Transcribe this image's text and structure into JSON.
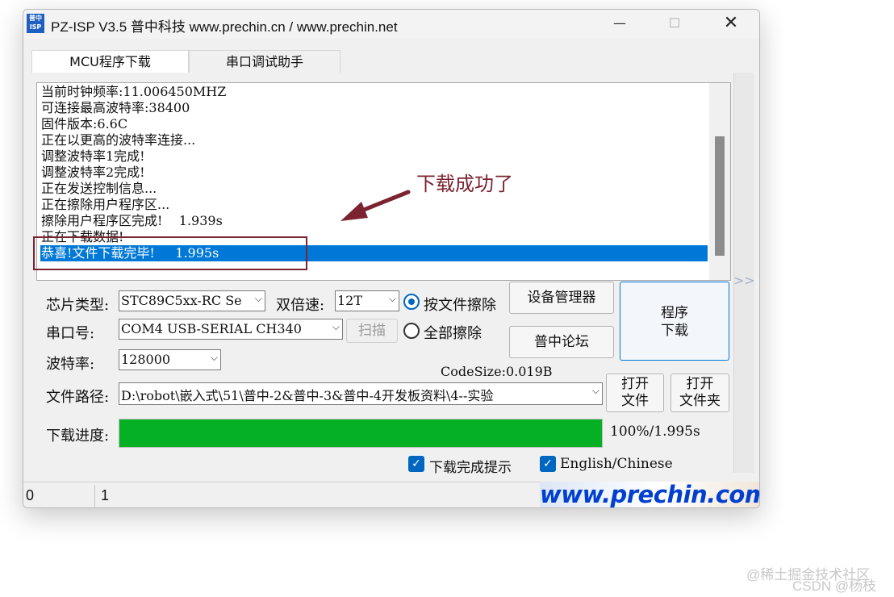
{
  "window": {
    "logo_text": "普中ISP",
    "title": "PZ-ISP V3.5 普中科技  www.prechin.cn / www.prechin.net",
    "minimize": "—",
    "maximize": "☐",
    "close": "✕"
  },
  "tabs": [
    {
      "label": "MCU程序下载",
      "active": true
    },
    {
      "label": "串口调试助手",
      "active": false
    }
  ],
  "log": {
    "lines": [
      "当前时钟频率:11.006450MHZ",
      "可连接最高波特率:38400",
      "固件版本:6.6C",
      "正在以更高的波特率连接...",
      "调整波特率1完成!",
      "调整波特率2完成!",
      "正在发送控制信息...",
      "正在擦除用户程序区...",
      "擦除用户程序区完成!    1.939s",
      "正在下载数据!"
    ],
    "selected_line": "恭喜!文件下载完毕!     1.995s"
  },
  "side_arrows": ">>",
  "form": {
    "chip_label": "芯片类型:",
    "chip_value": "STC89C5xx-RC Se",
    "double_speed_label": "双倍速:",
    "double_speed_value": "12T",
    "erase_by_file": "按文件擦除",
    "erase_all": "全部擦除",
    "erase_mode_selected": "按文件擦除",
    "device_manager": "设备管理器",
    "forum": "普中论坛",
    "program_line1": "程序",
    "program_line2": "下载",
    "port_label": "串口号:",
    "port_value": "COM4  USB-SERIAL CH340",
    "scan_button": "扫描",
    "baud_label": "波特率:",
    "baud_value": "128000",
    "codesize": "CodeSize:0.019B",
    "path_label": "文件路径:",
    "path_value": "D:\\robot\\嵌入式\\51\\普中-2&普中-3&普中-4开发板资料\\4--实验",
    "open_file_1": "打开",
    "open_file_2": "文件",
    "open_folder_1": "打开",
    "open_folder_2": "文件夹",
    "progress_label": "下载进度:",
    "progress_fraction": 1.0,
    "progress_text": "100%/1.995s",
    "check_done_prompt": "下载完成提示",
    "check_done_prompt_checked": true,
    "check_language": "English/Chinese",
    "check_language_checked": true,
    "check_mark": "✓",
    "dropdown_arrow": "⌵"
  },
  "status_bar": {
    "cell1": "0",
    "cell2": "1",
    "brand": "www.prechin.com"
  },
  "annotation": {
    "text": "下载成功了",
    "color": "#7b2330"
  },
  "watermarks": {
    "line1": "@稀土掘金技术社区",
    "line2": "CSDN @杨枝"
  },
  "colors": {
    "selection": "#0078d7",
    "progress_fill": "#06b025",
    "accent": "#0067c0"
  }
}
